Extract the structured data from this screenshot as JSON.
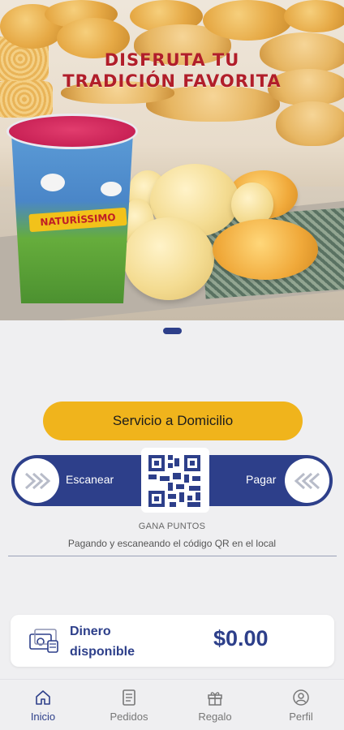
{
  "banner": {
    "headline_line1": "DISFRUTA TU",
    "headline_line2": "TRADICIÓN FAVORITA",
    "cup_brand": "NATURÍSSIMO"
  },
  "actions": {
    "delivery_label": "Servicio a Domicilio",
    "scan_label": "Escanear",
    "pay_label": "Pagar"
  },
  "points": {
    "title": "GANA PUNTOS",
    "subtitle": "Pagando y escaneando el código QR en el local"
  },
  "wallet": {
    "label": "Dinero disponible",
    "amount": "$0.00"
  },
  "nav": {
    "items": [
      {
        "label": "Inicio",
        "icon": "home-icon",
        "active": true
      },
      {
        "label": "Pedidos",
        "icon": "orders-icon",
        "active": false
      },
      {
        "label": "Regalo",
        "icon": "gift-icon",
        "active": false
      },
      {
        "label": "Perfil",
        "icon": "profile-icon",
        "active": false
      }
    ]
  },
  "colors": {
    "primary": "#2d3f8a",
    "accent": "#f0b41c",
    "headline": "#b11e2a",
    "background": "#efeff1"
  }
}
